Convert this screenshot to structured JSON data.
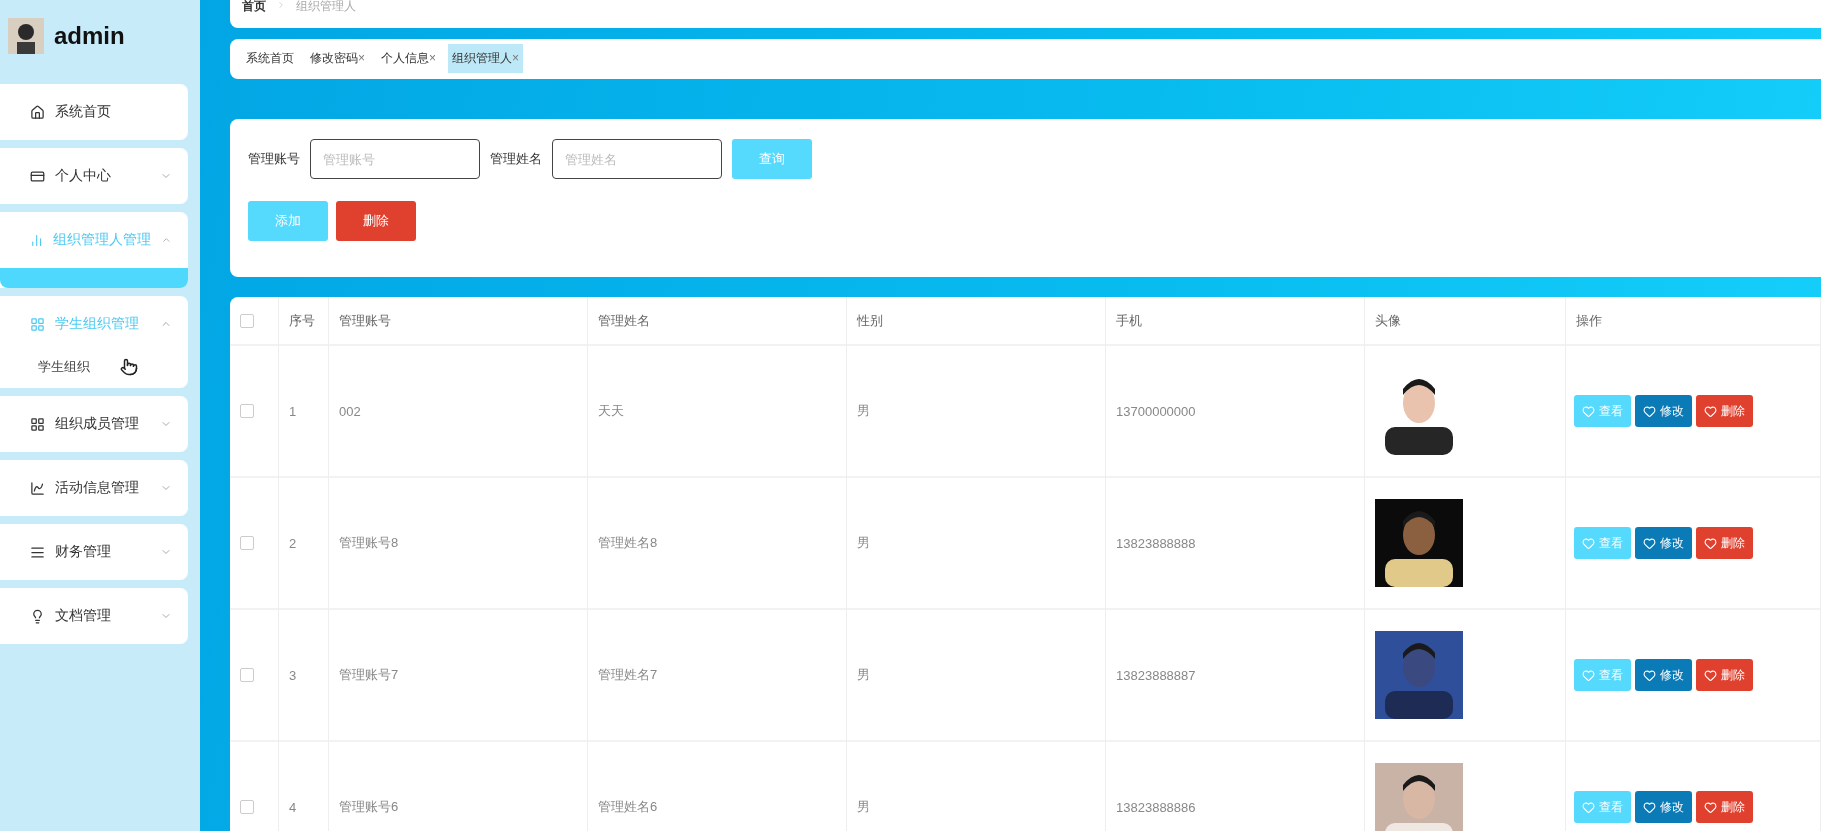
{
  "user": {
    "name": "admin"
  },
  "sidebar": {
    "items": [
      {
        "label": "系统首页",
        "kind": "link",
        "selected": false,
        "expanded": false
      },
      {
        "label": "个人中心",
        "kind": "submenu",
        "selected": false,
        "expanded": false
      },
      {
        "label": "组织管理人管理",
        "kind": "submenu",
        "selected": true,
        "expanded": true
      },
      {
        "label": "学生组织管理",
        "kind": "submenu",
        "selected": true,
        "expanded": true,
        "children": [
          {
            "label": "学生组织",
            "selected": false
          }
        ]
      },
      {
        "label": "组织成员管理",
        "kind": "submenu",
        "selected": false,
        "expanded": false
      },
      {
        "label": "活动信息管理",
        "kind": "submenu",
        "selected": false,
        "expanded": false
      },
      {
        "label": "财务管理",
        "kind": "submenu",
        "selected": false,
        "expanded": false
      },
      {
        "label": "文档管理",
        "kind": "submenu",
        "selected": false,
        "expanded": false
      }
    ]
  },
  "breadcrumb": [
    "首页",
    "组织管理人"
  ],
  "tabs": [
    {
      "label": "系统首页",
      "closable": false,
      "selected": false
    },
    {
      "label": "修改密码",
      "closable": true,
      "selected": false
    },
    {
      "label": "个人信息",
      "closable": true,
      "selected": false
    },
    {
      "label": "组织管理人",
      "closable": true,
      "selected": true
    }
  ],
  "close_glyph": "×",
  "search": {
    "fields": [
      {
        "label": "管理账号",
        "placeholder": "管理账号"
      },
      {
        "label": "管理姓名",
        "placeholder": "管理姓名"
      }
    ],
    "button": "查询"
  },
  "actions": [
    {
      "label": "添加",
      "kind": "add"
    },
    {
      "label": "删除",
      "kind": "delete"
    }
  ],
  "table": {
    "columns": [
      "序号",
      "管理账号",
      "管理姓名",
      "性别",
      "手机",
      "头像",
      "操作"
    ],
    "all_checked": false,
    "rows": [
      {
        "checked": false,
        "index": "1",
        "account": "002",
        "name": "天天",
        "gender": "男",
        "phone": "13700000000",
        "avatar": {
          "kind": "picture"
        },
        "actions": [
          {
            "label": "查看",
            "kind": "view"
          },
          {
            "label": "修改",
            "kind": "edit"
          },
          {
            "label": "删除",
            "kind": "delete"
          }
        ]
      },
      {
        "checked": false,
        "index": "2",
        "account": "管理账号8",
        "name": "管理姓名8",
        "gender": "男",
        "phone": "13823888888",
        "avatar": {
          "kind": "picture"
        },
        "actions": [
          {
            "label": "查看",
            "kind": "view"
          },
          {
            "label": "修改",
            "kind": "edit"
          },
          {
            "label": "删除",
            "kind": "delete"
          }
        ]
      },
      {
        "checked": false,
        "index": "3",
        "account": "管理账号7",
        "name": "管理姓名7",
        "gender": "男",
        "phone": "13823888887",
        "avatar": {
          "kind": "picture"
        },
        "actions": [
          {
            "label": "查看",
            "kind": "view"
          },
          {
            "label": "修改",
            "kind": "edit"
          },
          {
            "label": "删除",
            "kind": "delete"
          }
        ]
      },
      {
        "checked": false,
        "index": "4",
        "account": "管理账号6",
        "name": "管理姓名6",
        "gender": "男",
        "phone": "13823888886",
        "avatar": {
          "kind": "picture"
        },
        "actions": [
          {
            "label": "查看",
            "kind": "view"
          },
          {
            "label": "修改",
            "kind": "edit"
          },
          {
            "label": "删除",
            "kind": "delete"
          }
        ]
      }
    ]
  }
}
